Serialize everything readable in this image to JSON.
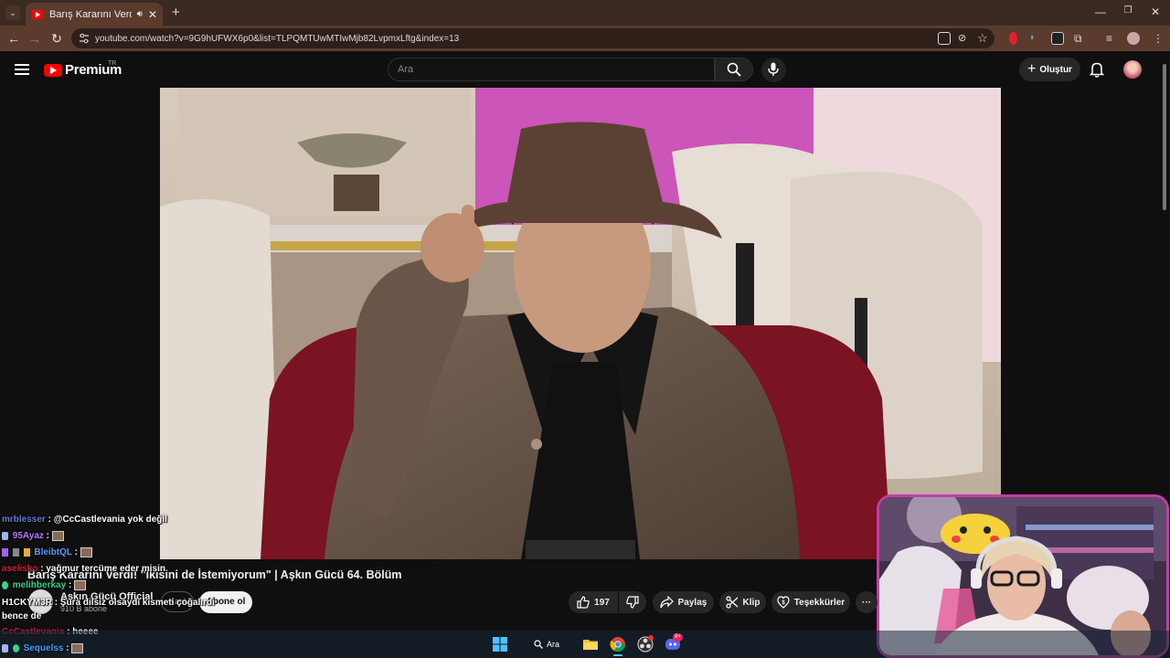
{
  "browser": {
    "tab_title": "Barış Kararını Verdi! \"İkisini",
    "url": "youtube.com/watch?v=9G9hUFWX6p0&list=TLPQMTUwMTIwMjb82LvpmxLftg&index=13"
  },
  "header": {
    "logo_text": "Premium",
    "logo_country": "TR",
    "search_placeholder": "Ara",
    "create_label": "Oluştur"
  },
  "video": {
    "title": "Barış Kararını Verdi! \"İkisini de İstemiyorum\" | Aşkın Gücü 64. Bölüm"
  },
  "channel": {
    "name": "Aşkın Gücü Official",
    "subscribers": "910 B abone",
    "join_label": "Katıl",
    "subscribe_label": "Abone ol"
  },
  "actions": {
    "likes": "197",
    "share_label": "Paylaş",
    "clip_label": "Klip",
    "thanks_label": "Teşekkürler",
    "more_label": "···"
  },
  "chat": [
    {
      "user": "mrblesser",
      "text": ": @CcCastlevania yok değil",
      "color": "#5b7bd5"
    },
    {
      "user": "95Ayaz",
      "text": ":",
      "color": "#b57bff"
    },
    {
      "user": "BleibtQL",
      "text": ":",
      "color": "#5b9bff"
    },
    {
      "user": "aselisko",
      "text": ": yağmur tercüme eder misin",
      "color": "#d0203b"
    },
    {
      "user": "melihberkay",
      "text": ":",
      "color": "#3ad08b"
    },
    {
      "user": "H1CKYM3R",
      "text": ": Şura dilsiz olsaydı kismeti çoğalırdı",
      "color": "#ffffff"
    },
    {
      "user": "",
      "text": "bence de",
      "color": "#ffffff"
    },
    {
      "user": "CcCastlevania",
      "text": ": heeee",
      "color": "#c0203b"
    },
    {
      "user": "Sequelss",
      "text": ":",
      "color": "#4aa0ff"
    }
  ],
  "taskbar": {
    "search_label": "Ara",
    "discord_badge": "9+"
  },
  "colors": {
    "youtube_red": "#ff0000",
    "browser_frame": "#5a3b2e",
    "webcam_border": "#c23ea5"
  }
}
